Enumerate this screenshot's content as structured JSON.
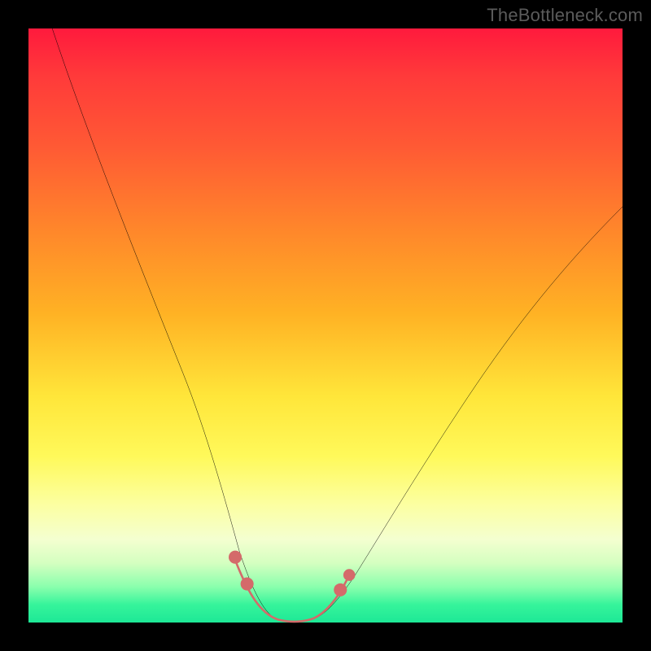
{
  "watermark": "TheBottleneck.com",
  "chart_data": {
    "type": "line",
    "title": "",
    "xlabel": "",
    "ylabel": "",
    "xlim": [
      0,
      100
    ],
    "ylim": [
      0,
      100
    ],
    "grid": false,
    "legend": false,
    "background_gradient_stops": [
      {
        "pos": 0,
        "color": "#ff1a3d"
      },
      {
        "pos": 20,
        "color": "#ff5a34"
      },
      {
        "pos": 48,
        "color": "#ffb224"
      },
      {
        "pos": 72,
        "color": "#fff95a"
      },
      {
        "pos": 90,
        "color": "#d4ffc0"
      },
      {
        "pos": 100,
        "color": "#1de896"
      }
    ],
    "series": [
      {
        "name": "bottleneck-curve",
        "color": "#000000",
        "x": [
          4,
          8,
          12,
          16,
          20,
          24,
          28,
          31,
          33.5,
          36,
          38,
          40,
          42,
          44,
          46,
          48,
          50,
          53,
          57,
          62,
          68,
          75,
          82,
          89,
          96,
          100
        ],
        "y": [
          100,
          88,
          76,
          65,
          54,
          43,
          33,
          24,
          16,
          9,
          4,
          1,
          0,
          0,
          0,
          1,
          3,
          7,
          13,
          21,
          30,
          40,
          49,
          58,
          66,
          70
        ]
      },
      {
        "name": "trough-markers",
        "color": "#d46a6a",
        "style": "points",
        "x": [
          35,
          37,
          39,
          41,
          43,
          45,
          47,
          49,
          51
        ],
        "y": [
          9,
          5,
          2,
          0,
          0,
          0,
          1,
          3,
          5
        ]
      }
    ]
  }
}
